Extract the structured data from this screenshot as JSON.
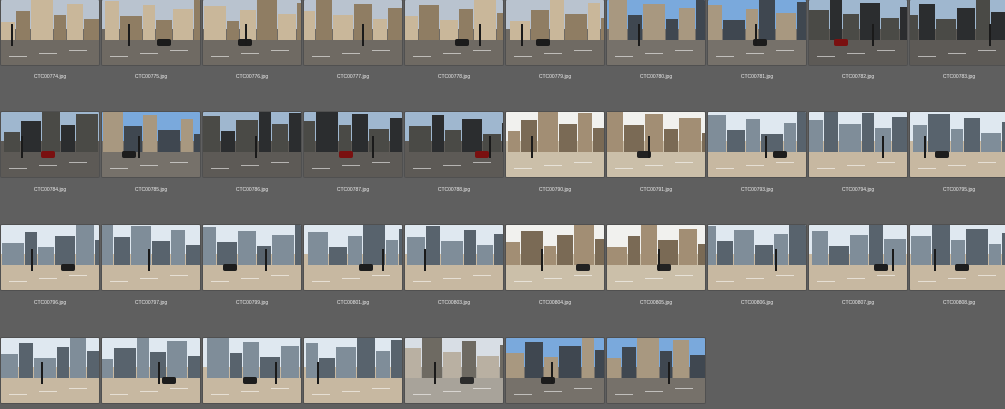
{
  "rows": [
    [
      {
        "file": "CTC00774.jpg",
        "theme": "tan"
      },
      {
        "file": "CTC00775.jpg",
        "theme": "tan"
      },
      {
        "file": "CTC00776.jpg",
        "theme": "tan"
      },
      {
        "file": "CTC00777.jpg",
        "theme": "tan"
      },
      {
        "file": "CTC00778.jpg",
        "theme": "tan"
      },
      {
        "file": "CTC00779.jpg",
        "theme": "tan"
      },
      {
        "file": "CTC00780.jpg",
        "theme": "blue"
      },
      {
        "file": "CTC00781.jpg",
        "theme": "blue"
      },
      {
        "file": "CTC00782.jpg",
        "theme": "dark"
      },
      {
        "file": "CTC00783.jpg",
        "theme": "dark"
      }
    ],
    [
      {
        "file": "CTC00784.jpg",
        "theme": "dark"
      },
      {
        "file": "CTC00785.jpg",
        "theme": "blue"
      },
      {
        "file": "CTC00786.jpg",
        "theme": "dark"
      },
      {
        "file": "CTC00787.jpg",
        "theme": "dark"
      },
      {
        "file": "CTC00788.jpg",
        "theme": "dark"
      },
      {
        "file": "CTC00790.jpg",
        "theme": "bright"
      },
      {
        "file": "CTC00791.jpg",
        "theme": "bright"
      },
      {
        "file": "CTC00793.jpg",
        "theme": "skyline"
      },
      {
        "file": "CTC00794.jpg",
        "theme": "skyline"
      },
      {
        "file": "CTC00795.jpg",
        "theme": "skyline"
      }
    ],
    [
      {
        "file": "CTC00796.jpg",
        "theme": "skyline"
      },
      {
        "file": "CTC00797.jpg",
        "theme": "skyline"
      },
      {
        "file": "CTC00799.jpg",
        "theme": "skyline"
      },
      {
        "file": "CTC00801.jpg",
        "theme": "skyline"
      },
      {
        "file": "CTC00803.jpg",
        "theme": "skyline"
      },
      {
        "file": "CTC00804.jpg",
        "theme": "bright"
      },
      {
        "file": "CTC00805.jpg",
        "theme": "bright"
      },
      {
        "file": "CTC00806.jpg",
        "theme": "skyline"
      },
      {
        "file": "CTC00807.jpg",
        "theme": "skyline"
      },
      {
        "file": "CTC00808.jpg",
        "theme": "skyline"
      }
    ],
    [
      {
        "file": "",
        "theme": "skyline"
      },
      {
        "file": "",
        "theme": "skyline"
      },
      {
        "file": "",
        "theme": "skyline"
      },
      {
        "file": "",
        "theme": "skyline"
      },
      {
        "file": "",
        "theme": "plaza"
      },
      {
        "file": "",
        "theme": "blue"
      },
      {
        "file": "",
        "theme": "blue"
      }
    ]
  ],
  "themes": {
    "tan": {
      "sky": "#b9c3cf",
      "bldg": "#c9b79a",
      "bldg2": "#8f7d63",
      "street": "#6f6a63",
      "car": "#1b1b1b"
    },
    "blue": {
      "sky": "#7aa9dc",
      "bldg": "#a89880",
      "bldg2": "#3f4750",
      "street": "#76716a",
      "car": "#1c1c1c"
    },
    "dark": {
      "sky": "#9fb7cf",
      "bldg": "#4a4a46",
      "bldg2": "#2b2d2f",
      "street": "#5d5a56",
      "car": "#7a1010"
    },
    "bright": {
      "sky": "#f1f1ee",
      "bldg": "#a28e74",
      "bldg2": "#7a6a55",
      "street": "#cbbfa9",
      "car": "#222"
    },
    "skyline": {
      "sky": "#dfe8f0",
      "bldg": "#7f8d99",
      "bldg2": "#58636d",
      "street": "#c7b8a1",
      "car": "#1d1d1d"
    },
    "plaza": {
      "sky": "#d8dee5",
      "bldg": "#b9b0a2",
      "bldg2": "#6e6a62",
      "street": "#a8a39a",
      "car": "#2c2c2c"
    }
  }
}
